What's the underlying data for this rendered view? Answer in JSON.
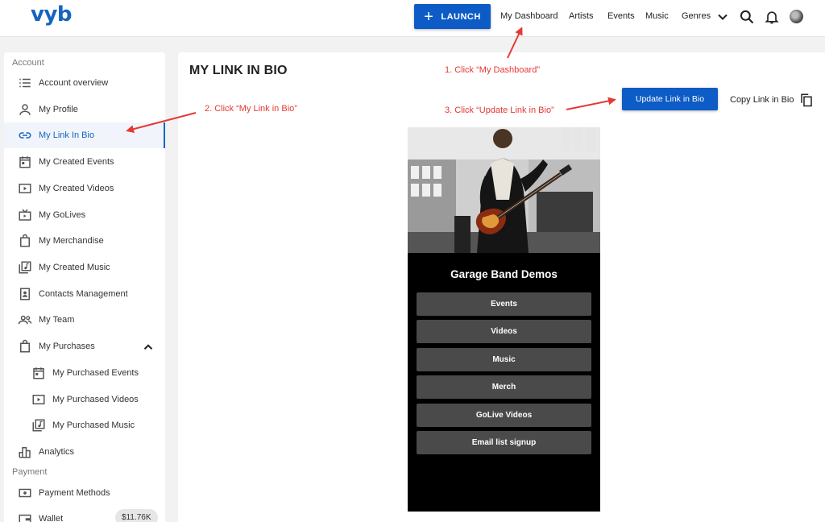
{
  "header": {
    "logo": "vyb",
    "launch_label": "LAUNCH",
    "nav": [
      "My Dashboard",
      "Artists",
      "Events",
      "Music",
      "Genres"
    ]
  },
  "sidebar": {
    "section_account": "Account",
    "section_payment": "Payment",
    "items": [
      {
        "label": "Account overview",
        "icon": "list-icon"
      },
      {
        "label": "My Profile",
        "icon": "person-icon"
      },
      {
        "label": "My Link In Bio",
        "icon": "link-icon"
      },
      {
        "label": "My Created Events",
        "icon": "calendar-icon"
      },
      {
        "label": "My Created Videos",
        "icon": "video-icon"
      },
      {
        "label": "My GoLives",
        "icon": "tv-icon"
      },
      {
        "label": "My Merchandise",
        "icon": "bag-icon"
      },
      {
        "label": "My Created Music",
        "icon": "music-icon"
      },
      {
        "label": "Contacts Management",
        "icon": "contact-icon"
      },
      {
        "label": "My Team",
        "icon": "team-icon"
      },
      {
        "label": "My Purchases",
        "icon": "bag-icon"
      },
      {
        "label": "My Purchased Events",
        "icon": "calendar-icon"
      },
      {
        "label": "My Purchased Videos",
        "icon": "video-icon"
      },
      {
        "label": "My Purchased Music",
        "icon": "music-icon"
      },
      {
        "label": "Analytics",
        "icon": "chart-icon"
      },
      {
        "label": "Payment Methods",
        "icon": "payment-icon"
      },
      {
        "label": "Wallet",
        "icon": "wallet-icon"
      }
    ],
    "wallet_balance": "$11.76K"
  },
  "main": {
    "title": "MY LINK IN BIO",
    "update_label": "Update Link in Bio",
    "copy_label": "Copy Link in Bio"
  },
  "preview": {
    "band_name": "Garage Band Demos",
    "links": [
      "Events",
      "Videos",
      "Music",
      "Merch",
      "GoLive Videos",
      "Email list signup"
    ]
  },
  "annotations": {
    "step1": "1. Click “My Dashboard”",
    "step2": "2. Click “My Link in Bio”",
    "step3": "3. Click “Update Link in Bio”"
  },
  "colors": {
    "brand": "#1565c0",
    "button": "#0d5bc6",
    "annotation": "#e53935",
    "preview_bg": "#000000",
    "link_button": "#4a4a4a"
  }
}
